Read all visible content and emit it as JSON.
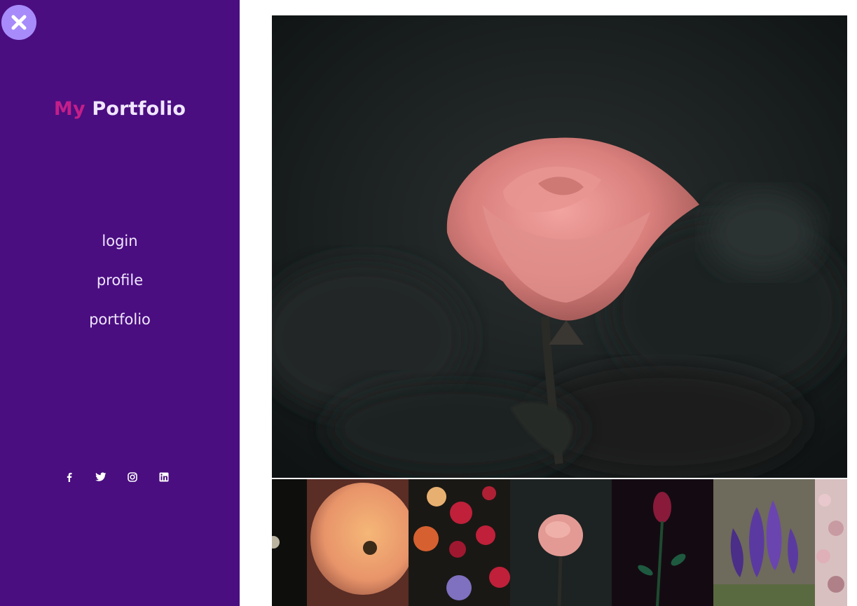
{
  "sidebar": {
    "brand": {
      "part1": "My",
      "part2": "Portfolio"
    },
    "nav": [
      {
        "label": "login"
      },
      {
        "label": "profile"
      },
      {
        "label": "portfolio"
      }
    ],
    "social": [
      "facebook-icon",
      "twitter-icon",
      "instagram-icon",
      "linkedin-icon"
    ],
    "colors": {
      "background": "#4a0e80",
      "accent": "#c41e8a",
      "close_button": "#a78bfa"
    }
  },
  "gallery": {
    "main_image": "pink-rose-photo",
    "thumbnails": [
      "dark-flower",
      "peach-rose",
      "bouquet",
      "pink-rose",
      "dark-red-rose",
      "purple-crocus",
      "cherry-blossom"
    ]
  }
}
